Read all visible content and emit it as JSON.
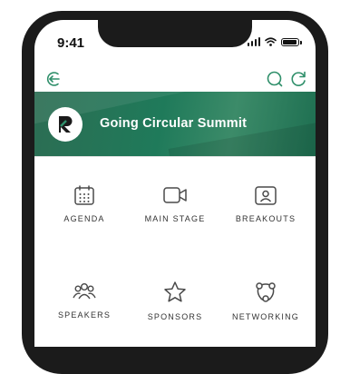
{
  "status_bar": {
    "time": "9:41"
  },
  "banner": {
    "title": "Going Circular Summit"
  },
  "tiles": [
    {
      "label": "AGENDA",
      "icon": "calendar-icon"
    },
    {
      "label": "MAIN STAGE",
      "icon": "video-camera-icon"
    },
    {
      "label": "BREAKOUTS",
      "icon": "breakout-room-icon"
    },
    {
      "label": "SPEAKERS",
      "icon": "people-group-icon"
    },
    {
      "label": "SPONSORS",
      "icon": "star-icon"
    },
    {
      "label": "NETWORKING",
      "icon": "network-icon"
    }
  ],
  "colors": {
    "accent": "#1f7a5a",
    "icon": "#4a4a4a",
    "label": "#333333"
  }
}
